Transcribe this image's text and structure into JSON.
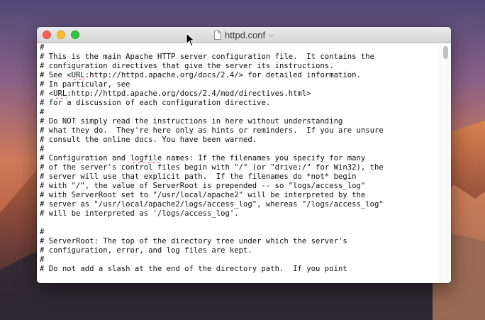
{
  "window": {
    "title": "httpd.conf",
    "title_menu_icon": "chevron-down-icon",
    "document_icon": "document-icon"
  },
  "editor": {
    "lines": [
      "#",
      "# This is the main Apache HTTP server configuration file.  It contains the",
      "# configuration directives that give the server its instructions.",
      "# See <URL:http://httpd.apache.org/docs/2.4/> for detailed information.",
      "# In particular, see",
      "# <URL:http://httpd.apache.org/docs/2.4/mod/directives.html>",
      "# for a discussion of each configuration directive.",
      "#",
      "# Do NOT simply read the instructions in here without understanding",
      "# what they do.  They're here only as hints or reminders.  If you are unsure",
      "# consult the online docs. You have been warned.",
      "#",
      "# Configuration and logfile names: If the filenames you specify for many",
      "# of the server's control files begin with \"/\" (or \"drive:/\" for Win32), the",
      "# server will use that explicit path.  If the filenames do *not* begin",
      "# with \"/\", the value of ServerRoot is prepended -- so \"logs/access_log\"",
      "# with ServerRoot set to \"/usr/local/apache2\" will be interpreted by the",
      "# server as \"/usr/local/apache2/logs/access_log\", whereas \"/logs/access_log\"",
      "# will be interpreted as '/logs/access_log'.",
      "",
      "#",
      "# ServerRoot: The top of the directory tree under which the server's",
      "# configuration, error, and log files are kept.",
      "#",
      "# Do not add a slash at the end of the directory path.  If you point"
    ]
  },
  "colors": {
    "close": "#fc5f57",
    "minimize": "#fdbc2e",
    "zoom": "#28c840",
    "spellcheck": "#e0413c"
  }
}
